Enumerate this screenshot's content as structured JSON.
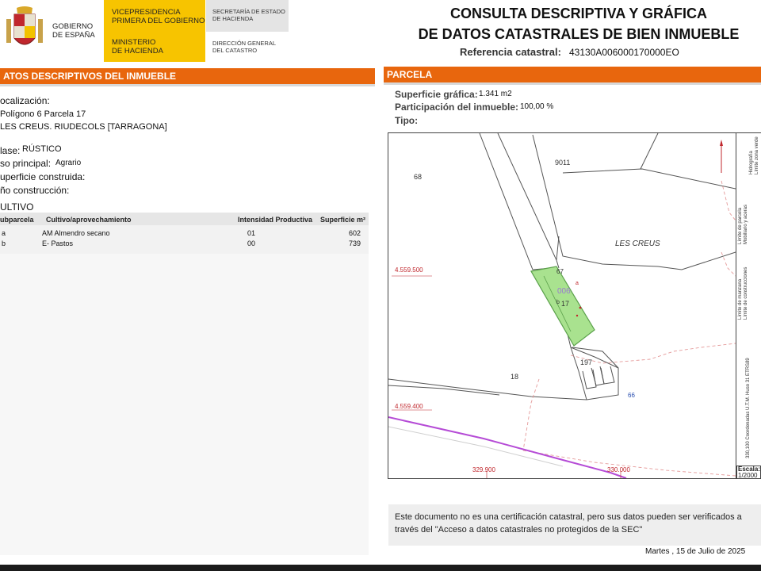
{
  "header": {
    "gobierno_lines": [
      "GOBIERNO",
      "DE ESPAÑA"
    ],
    "vicepresidencia_lines": [
      "VICEPRESIDENCIA",
      "PRIMERA DEL GOBIERNO"
    ],
    "ministerio_lines": [
      "MINISTERIO",
      "DE HACIENDA"
    ],
    "secretaria_lines": [
      "SECRETARÍA DE ESTADO",
      "DE HACIENDA"
    ],
    "direccion_lines": [
      "DIRECCIÓN GENERAL",
      "DEL CATASTRO"
    ],
    "title_line1": "CONSULTA DESCRIPTIVA Y GRÁFICA",
    "title_line2": "DE DATOS CATASTRALES DE BIEN INMUEBLE",
    "refcat_label": "Referencia catastral:",
    "refcat_value": "43130A006000170000EO"
  },
  "left": {
    "section_title": "ATOS DESCRIPTIVOS DEL INMUEBLE",
    "localizacion_label": "ocalización:",
    "localizacion_line1": "Polígono 6 Parcela 17",
    "localizacion_line2": "LES CREUS. RIUDECOLS [TARRAGONA]",
    "clase_label": "lase:",
    "clase_value": "RÚSTICO",
    "uso_label": "so principal:",
    "uso_value": "Agrario",
    "superficie_label": "uperficie construida:",
    "anio_label": "ño construcción:",
    "cultivo_title": "ULTIVO",
    "table": {
      "headers": [
        "ubparcela",
        "Cultivo/aprovechamiento",
        "Intensidad Productiva",
        "Superficie m²"
      ],
      "rows": [
        [
          "a",
          "AM Almendro secano",
          "01",
          "602"
        ],
        [
          "b",
          "E- Pastos",
          "00",
          "739"
        ]
      ]
    }
  },
  "right": {
    "section_title": "PARCELA",
    "superficie_label": "Superficie gráfica:",
    "superficie_value": "1.341 m2",
    "participacion_label": "Participación del inmueble:",
    "participacion_value": "100,00 %",
    "tipo_label": "Tipo:"
  },
  "map": {
    "labels": {
      "p68": "68",
      "p9011": "9011",
      "les_creus": "LES CREUS",
      "p67": "67",
      "p006": "006",
      "a": "a",
      "b": "b",
      "p17": "17",
      "p197": "197",
      "p18": "18",
      "p66": "66",
      "y1": "4.559.500",
      "y2": "4.559.400",
      "x1": "329.900",
      "x2": "330.000"
    },
    "legend": [
      "Límite de parcela",
      "Mobiliario y aceras",
      "Límite de manzana",
      "Límite de construcciones",
      "Hidrografía",
      "Límite zona verde",
      "330,100 Coordenadas U.T.M. Huso 31 ETRS89"
    ],
    "escala_label": "Escala:",
    "escala_value": "1/2000",
    "colors": {
      "parcel_fill": "#a9e28f",
      "parcel_stroke": "#5aa04a",
      "road": "#b54bd6",
      "limit_dashed": "#e59a9a"
    }
  },
  "footer": {
    "notice_line1": "Este documento no es una certificación catastral, pero sus datos pueden ser verificados a",
    "notice_line2": "través del \"Acceso a datos catastrales no protegidos de la SEC\"",
    "date": "Martes , 15 de Julio de 2025"
  },
  "colors": {
    "orange": "#e8660d",
    "yellow": "#f7c400"
  }
}
